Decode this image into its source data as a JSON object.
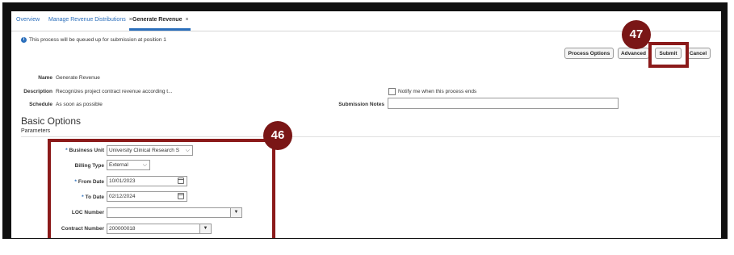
{
  "tabs": [
    {
      "label": "Overview",
      "closable": false
    },
    {
      "label": "Manage Revenue Distributions",
      "closable": true
    },
    {
      "label": "Generate Revenue",
      "closable": true,
      "active": true
    }
  ],
  "tab_close_glyph": "×",
  "info_message": "This process will be queued up for submission at position 1",
  "buttons": {
    "process_options": "Process Options",
    "advanced": "Advanced",
    "submit": "Submit",
    "cancel": "Cancel"
  },
  "details": {
    "name_label": "Name",
    "name_value": "Generate Revenue",
    "description_label": "Description",
    "description_value": "Recognizes project contract revenue according t...",
    "schedule_label": "Schedule",
    "schedule_value": "As soon as possible",
    "notify_label": "Notify me when this process ends",
    "submission_notes_label": "Submission Notes",
    "submission_notes_value": ""
  },
  "basic_options": {
    "heading": "Basic Options",
    "parameters_heading": "Parameters",
    "required_marker": "*",
    "business_unit_label": "Business Unit",
    "business_unit_value": "University Clinical Research S",
    "billing_type_label": "Billing Type",
    "billing_type_value": "External",
    "from_date_label": "From Date",
    "from_date_value": "10/01/2023",
    "to_date_label": "To Date",
    "to_date_value": "02/12/2024",
    "loc_number_label": "LOC Number",
    "loc_number_value": "",
    "contract_number_label": "Contract Number",
    "contract_number_value": "200000018"
  },
  "annotations": {
    "step_46": "46",
    "step_47": "47",
    "highlight_color": "#8b1a1a",
    "badge_color": "#7a1616"
  },
  "icons": {
    "info": "info-icon",
    "chevron": "chevron-down-icon",
    "calendar": "calendar-icon",
    "dropdown": "dropdown-triangle-icon"
  },
  "colors": {
    "accent": "#2a6ebb"
  }
}
